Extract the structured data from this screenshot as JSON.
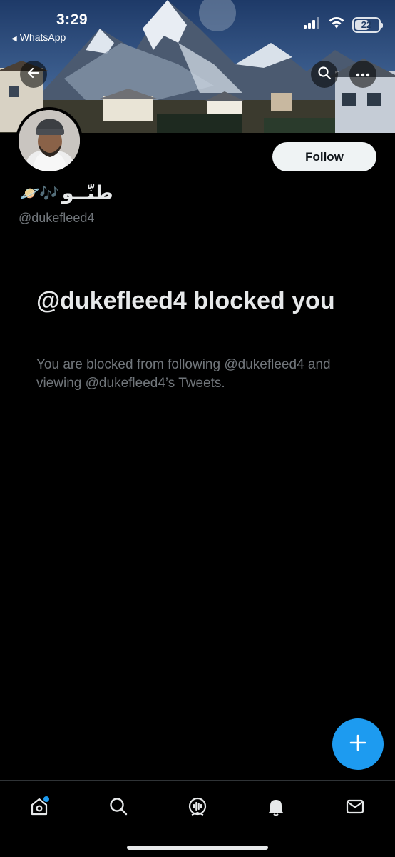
{
  "status_bar": {
    "time": "3:29",
    "back_app": "WhatsApp",
    "battery_level": "22",
    "icons": [
      "signal-icon",
      "wifi-icon",
      "battery-icon"
    ]
  },
  "profile": {
    "display_name": "طنّــو",
    "name_emojis": "🪐🎶",
    "handle": "@dukefleed4",
    "follow_label": "Follow"
  },
  "blocked": {
    "title": "@dukefleed4 blocked you",
    "description": "You are blocked from following @dukefleed4 and viewing @dukefleed4’s Tweets."
  },
  "nav": {
    "items": [
      "home-icon",
      "search-icon",
      "spaces-icon",
      "notifications-icon",
      "messages-icon"
    ],
    "home_has_badge": true
  },
  "colors": {
    "background": "#000000",
    "accent": "#1d9bf0",
    "text_primary": "#e7e9ea",
    "text_secondary": "#71767b",
    "follow_bg": "#eff3f4"
  }
}
